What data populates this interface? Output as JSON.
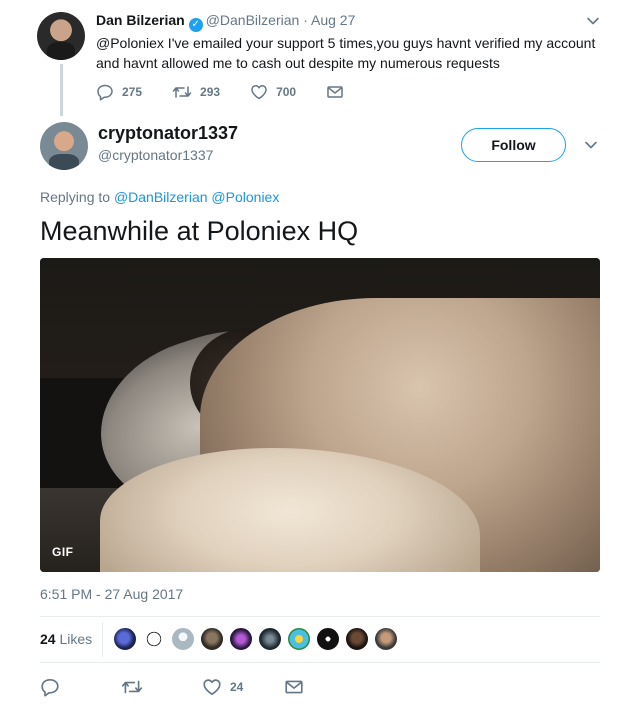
{
  "parent_tweet": {
    "name": "Dan Bilzerian",
    "handle": "@DanBilzerian",
    "separator": "·",
    "date": "Aug 27",
    "text": "@Poloniex I've emailed your support 5 times,you guys havnt verified my account and havnt allowed me to cash out despite my numerous requests",
    "replies": "275",
    "retweets": "293",
    "likes": "700",
    "icons": [
      "reply-icon",
      "retweet-icon",
      "like-icon",
      "message-icon",
      "verified-icon",
      "chevron-down-icon"
    ]
  },
  "main_tweet": {
    "name": "cryptonator1337",
    "handle": "@cryptonator1337",
    "follow_label": "Follow",
    "replying_prefix": "Replying to",
    "replying_to": [
      "@DanBilzerian",
      "@Poloniex"
    ],
    "text": "Meanwhile at Poloniex HQ",
    "media_badge": "GIF",
    "timestamp": "6:51 PM - 27 Aug 2017",
    "likes_count": "24",
    "likes_label": "Likes",
    "liker_avatars": 10,
    "likes_action_count": "24"
  },
  "colors": {
    "accent": "#1da1f2",
    "link": "#1b95e0",
    "muted": "#657786",
    "text": "#14171a",
    "divider": "#e6ecf0"
  }
}
